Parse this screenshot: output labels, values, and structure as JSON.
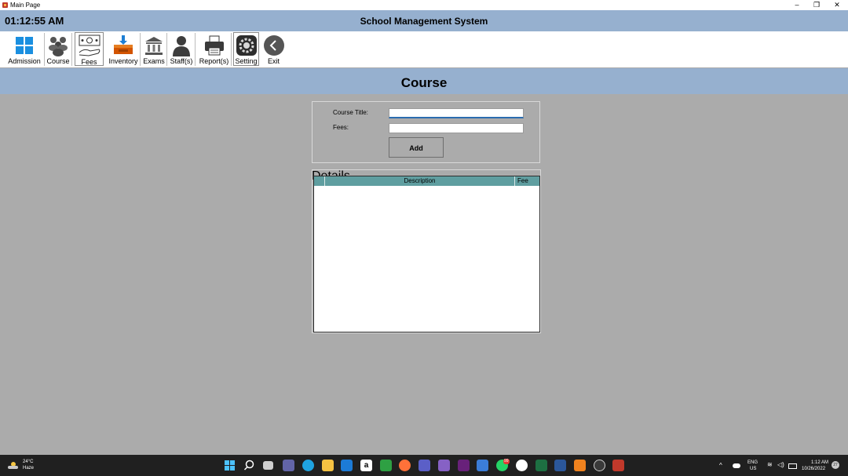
{
  "window": {
    "title": "Main Page",
    "minimize": "–",
    "restore": "❐",
    "close": "✕"
  },
  "header": {
    "clock": "01:12:55 AM",
    "title": "School Management System"
  },
  "toolbar": {
    "items": [
      {
        "label": "Admission",
        "icon": "windows-tiles-icon"
      },
      {
        "label": "Course",
        "icon": "group-icon"
      },
      {
        "label": "Fees",
        "icon": "money-icon"
      },
      {
        "label": "Inventory",
        "icon": "inbox-icon"
      },
      {
        "label": "Exams",
        "icon": "building-icon"
      },
      {
        "label": "Staff(s)",
        "icon": "person-icon"
      },
      {
        "label": "Report(s)",
        "icon": "printer-icon"
      },
      {
        "label": "Setting",
        "icon": "gear-icon"
      },
      {
        "label": "Exit",
        "icon": "back-arrow-icon"
      }
    ]
  },
  "page": {
    "heading": "Course"
  },
  "form": {
    "course_title_label": "Course Title:",
    "course_title_value": "",
    "fees_label": "Fees:",
    "fees_value": "",
    "add_label": "Add"
  },
  "details": {
    "legend": "Details",
    "columns": [
      "",
      "Description",
      "Fee"
    ],
    "rows": []
  },
  "taskbar": {
    "weather_temp": "24°C",
    "weather_condition": "Haze",
    "language": "ENG",
    "region": "US",
    "time": "1:12 AM",
    "date": "10/26/2022",
    "notification_count": "27",
    "whatsapp_badge": "99"
  },
  "colors": {
    "header_bg": "#96b0cf",
    "grid_header": "#5f9ea0",
    "page_bg": "#ababab",
    "taskbar": "#202020"
  }
}
